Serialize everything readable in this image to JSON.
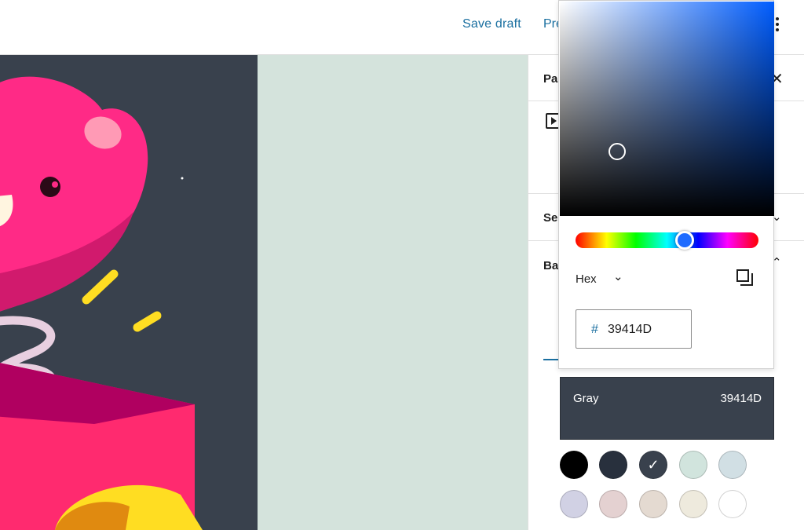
{
  "topbar": {
    "save_draft": "Save draft",
    "preview": "Pre",
    "more_icon": "kebab-menu-icon"
  },
  "sidebar": {
    "tab_label": "Pa",
    "close_icon": "close-icon",
    "section_settings": "Se",
    "section_background": "Ba",
    "chevron_down": "⌄",
    "chevron_up": "⌃"
  },
  "color_picker": {
    "format": "Hex",
    "format_chevron": "⌄",
    "hex_prefix": "#",
    "hex_value": "39414D",
    "hue_color": "#005dff",
    "copy_icon": "copy-icon"
  },
  "selected_color": {
    "name": "Gray",
    "hex": "39414D"
  },
  "swatches": [
    {
      "name": "black",
      "color": "#000000",
      "selected": false
    },
    {
      "name": "dark-navy",
      "color": "#28303d",
      "selected": false
    },
    {
      "name": "gray",
      "color": "#39414D",
      "selected": true,
      "check": "✓"
    },
    {
      "name": "green",
      "color": "#d1e4dd",
      "selected": false
    },
    {
      "name": "blue",
      "color": "#d1dfe4",
      "selected": false
    },
    {
      "name": "purple",
      "color": "#d1d1e4",
      "selected": false
    },
    {
      "name": "red",
      "color": "#e4d1d1",
      "selected": false
    },
    {
      "name": "orange",
      "color": "#e4dad1",
      "selected": false
    },
    {
      "name": "yellow",
      "color": "#eeeadd",
      "selected": false
    },
    {
      "name": "white",
      "color": "#ffffff",
      "selected": false
    }
  ],
  "canvas": {
    "left_bg": "#39414D",
    "right_bg": "#d4e3dc"
  }
}
